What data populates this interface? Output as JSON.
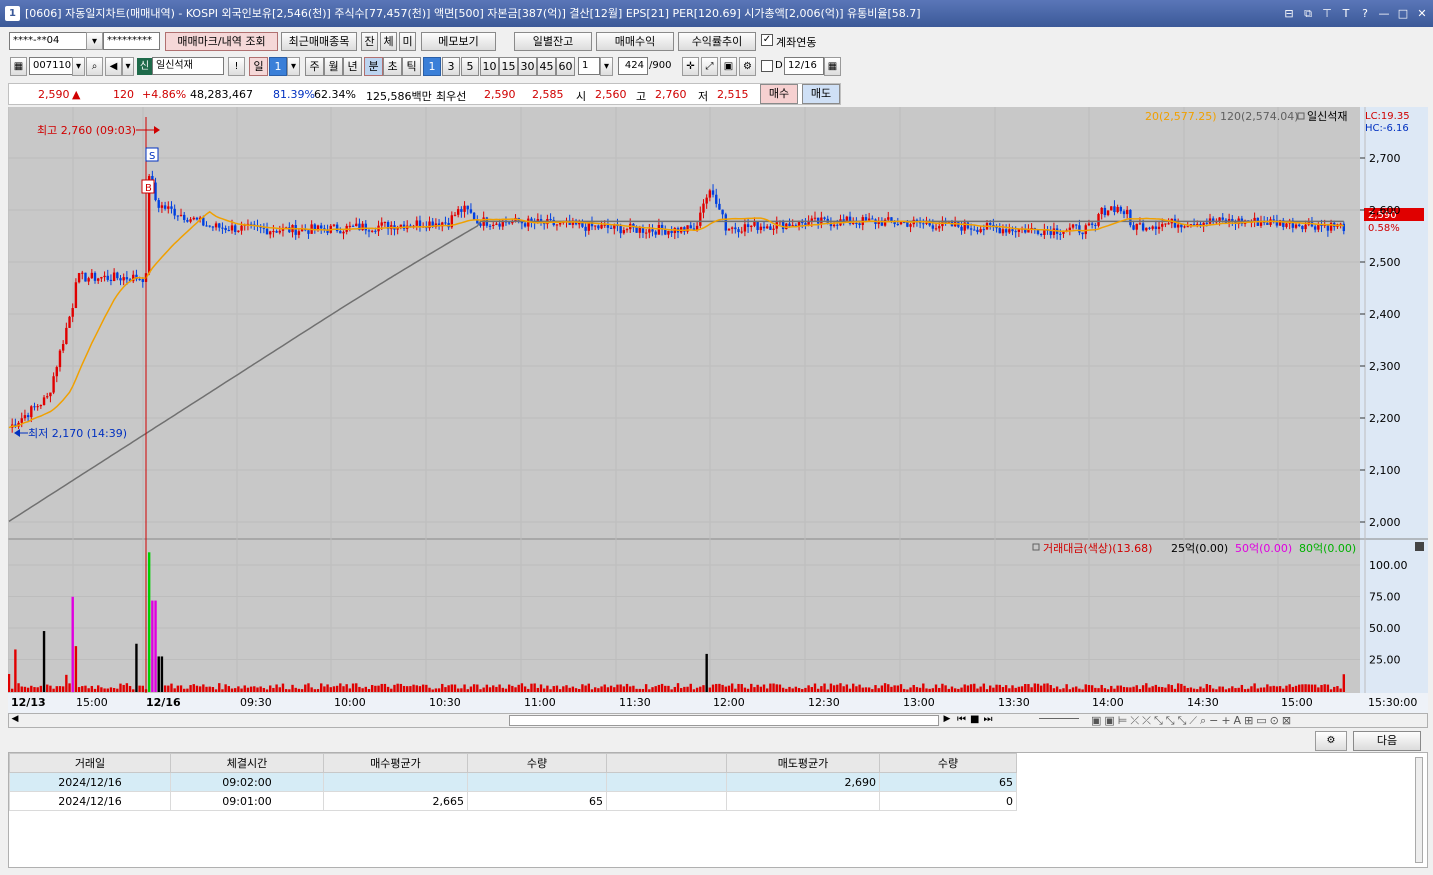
{
  "window": {
    "title": "[0606] 자동일지차트(매매내역) - KOSPI 외국인보유[2,546(천)] 주식수[77,457(천)] 액면[500] 자본금[387(억)] 결산[12월] EPS[21] PER[120.69] 시가총액[2,006(억)] 유통비율[58.7]",
    "app_icon": "1"
  },
  "toolbar1": {
    "account": "****-**04",
    "password": "*********",
    "tab_trade_mark": "매매마크/내역 조회",
    "tab_recent": "최근매매종목",
    "btn_jan": "잔",
    "btn_che": "체",
    "btn_mi": "미",
    "btn_memo": "메모보기",
    "btn_daily_balance": "일별잔고",
    "btn_trade_profit": "매매수익",
    "btn_profit_trend": "수익률추이",
    "account_link_label": "계좌연동",
    "account_link_checked": true
  },
  "toolbar2": {
    "code": "007110",
    "badge": "신",
    "stock_name": "일신석재",
    "excl": "!",
    "periods": [
      "일",
      "1",
      "주",
      "월",
      "년",
      "분",
      "초",
      "틱"
    ],
    "active_period": "분",
    "intervals": [
      "1",
      "3",
      "5",
      "10",
      "15",
      "30",
      "45",
      "60"
    ],
    "active_interval": "1",
    "custom_interval": "1",
    "count": "424",
    "count_max": "/900",
    "date_checkbox_label": "D",
    "date": "12/16"
  },
  "infobar": {
    "price": "2,590",
    "arrow": "▲",
    "change": "120",
    "change_pct": "+4.86%",
    "volume": "48,283,467",
    "vol_ratio": "81.39%",
    "turnover_ratio": "62.34%",
    "amount": "125,586백만",
    "best_label": "최우선",
    "best_ask": "2,590",
    "best_bid": "2,585",
    "open_label": "시",
    "open": "2,560",
    "high_label": "고",
    "high": "2,760",
    "low_label": "저",
    "low": "2,515",
    "buy_btn": "매수",
    "sell_btn": "매도"
  },
  "chart": {
    "legend_ma20": "20(2,577.25)",
    "legend_ma120": "120(2,574.04)",
    "legend_name": "일신석재",
    "lc": "LC:19.35",
    "hc": "HC:-6.16",
    "current_tag": "2,590",
    "current_pct": "0.58%",
    "high_annot": "최고 2,760 (09:03)",
    "low_annot": "최저 2,170 (14:39)",
    "marker_s": "S",
    "marker_b": "B",
    "price_ticks": [
      "2,700",
      "2,600",
      "2,500",
      "2,400",
      "2,300",
      "2,200",
      "2,100",
      "2,000"
    ],
    "vol_legend": "거래대금(색상)(13.68)",
    "vol_legend_25": "25억(0.00)",
    "vol_legend_50": "50억(0.00)",
    "vol_legend_80": "80억(0.00)",
    "vol_ticks": [
      "100.00",
      "75.00",
      "50.00",
      "25.00"
    ],
    "time_labels": [
      "12/13",
      "15:00",
      "12/16",
      "09:30",
      "10:00",
      "10:30",
      "11:00",
      "11:30",
      "12:00",
      "12:30",
      "13:00",
      "13:30",
      "14:00",
      "14:30",
      "15:00",
      "15:30:00"
    ],
    "colors": {
      "up": "#e00000",
      "down": "#0040e0",
      "ma20": "#f0a000",
      "ma120": "#707070",
      "bg": "#c8c8c8"
    }
  },
  "bottom_buttons": {
    "next": "다음"
  },
  "trade_table": {
    "headers": [
      "거래일",
      "체결시간",
      "매수평균가",
      "수량",
      "",
      "매도평균가",
      "수량"
    ],
    "rows": [
      [
        "2024/12/16",
        "09:02:00",
        "",
        "",
        "",
        "2,690",
        "65"
      ],
      [
        "2024/12/16",
        "09:01:00",
        "2,665",
        "65",
        "",
        "",
        "0"
      ]
    ]
  }
}
